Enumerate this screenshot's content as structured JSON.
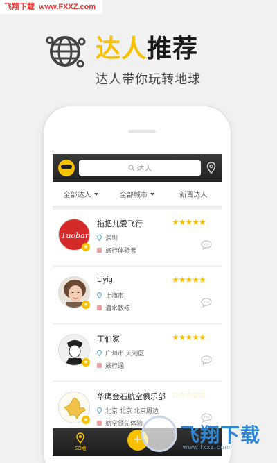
{
  "watermark": {
    "left": "飞翔下载",
    "right": "www.FXXZ.com"
  },
  "promo": {
    "title_highlight": "达人",
    "title_rest": "推荐",
    "subtitle": "达人带你玩转地球"
  },
  "search": {
    "placeholder": "达人"
  },
  "filters": [
    {
      "label": "全部达人",
      "dropdown": true
    },
    {
      "label": "全部城市",
      "dropdown": true
    },
    {
      "label": "新晋达人",
      "dropdown": false
    }
  ],
  "experts": [
    {
      "name": "拖把儿爱飞行",
      "city": "深圳",
      "role": "旅行体验者",
      "rating": 5,
      "avatar_text": "Tuobar",
      "avatar_color": "#d42a2a"
    },
    {
      "name": "Liyig",
      "city": "上海市",
      "role": "潜水教练",
      "rating": 5,
      "avatar_text": "",
      "avatar_color": "#c9a48a"
    },
    {
      "name": "丁伯家",
      "city": "广州市 天河区",
      "role": "旅行通",
      "rating": 5,
      "avatar_text": "",
      "avatar_color": "#d9d9d9"
    },
    {
      "name": "华鹰金石航空俱乐部",
      "city": "北京 北京 北京周边",
      "role": "航空领先体验",
      "rating": 0,
      "avatar_text": "",
      "avatar_color": "#f2d36b"
    }
  ],
  "tabbar": {
    "home_label": "SO地",
    "plus": "+"
  },
  "corner_watermark": {
    "title": "飞翔下载",
    "url": "www.fxxz.com"
  },
  "colors": {
    "accent": "#f7c100",
    "dark": "#222222"
  }
}
